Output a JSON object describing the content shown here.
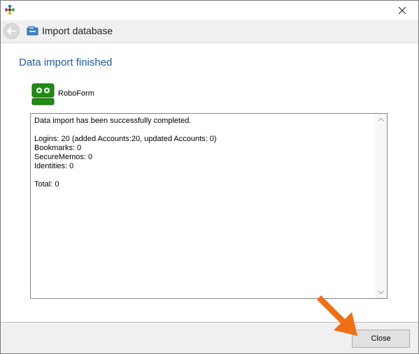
{
  "titlebar": {
    "close_label": "✕"
  },
  "nav": {
    "title": "Import database",
    "back_label": "←"
  },
  "main": {
    "heading": "Data import finished",
    "product_name": "RoboForm",
    "report_lines": [
      "Data import has been successfully completed.",
      "",
      "Logins: 20 (added Accounts:20, updated Accounts: 0)",
      "Bookmarks: 0",
      "SecureMemos: 0",
      "Identities: 0",
      "",
      "Total: 0"
    ]
  },
  "footer": {
    "close_label": "Close"
  },
  "colors": {
    "heading": "#1e5aa8",
    "logo_green": "#1f8c12",
    "arrow": "#ef6f14"
  },
  "icons": [
    "app-logo-icon",
    "close-icon",
    "back-arrow-icon",
    "database-icon",
    "roboform-logo-icon",
    "scroll-up-icon",
    "scroll-down-icon",
    "pointer-arrow-icon"
  ]
}
